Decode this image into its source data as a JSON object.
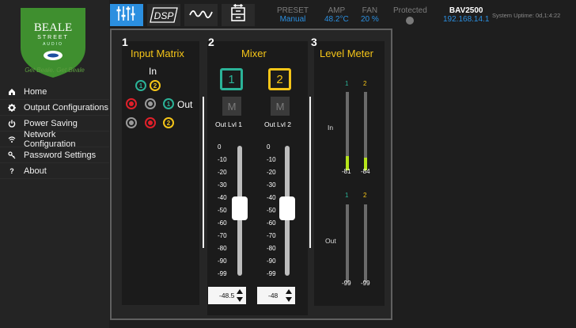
{
  "brand": {
    "name_line1": "BEALE",
    "name_line2": "STREET",
    "name_line3": "AUDIO",
    "tagline": "Get Beale. Get Beale"
  },
  "nav": [
    {
      "label": "Home",
      "icon": "home-icon"
    },
    {
      "label": "Output Configurations",
      "icon": "gear-icon"
    },
    {
      "label": "Power Saving",
      "icon": "power-icon"
    },
    {
      "label": "Network Configuration",
      "icon": "wifi-icon"
    },
    {
      "label": "Password Settings",
      "icon": "key-icon"
    },
    {
      "label": "About",
      "icon": "question-icon"
    }
  ],
  "tabs": [
    {
      "name": "mixer-sliders",
      "label": ""
    },
    {
      "name": "dsp",
      "label": "DSP"
    },
    {
      "name": "eq-curve",
      "label": ""
    },
    {
      "name": "device",
      "label": ""
    }
  ],
  "status": {
    "preset_label": "PRESET",
    "preset_value": "Manual",
    "amp_label": "AMP",
    "amp_value": "48.2°C",
    "fan_label": "FAN",
    "fan_value": "20 %",
    "protected_label": "Protected",
    "model": "BAV2500",
    "ip": "192.168.14.1",
    "uptime": "System Uptime: 0d,1:4:22"
  },
  "input_matrix": {
    "number": "1",
    "title": "Input Matrix",
    "in_label": "In",
    "out_label": "Out",
    "inputs": [
      "1",
      "2"
    ],
    "outputs": [
      "1",
      "2"
    ]
  },
  "mixer": {
    "number": "2",
    "title": "Mixer",
    "mute_label": "M",
    "scale": [
      "0",
      "-10",
      "-20",
      "-30",
      "-40",
      "-50",
      "-60",
      "-70",
      "-80",
      "-90",
      "-99"
    ],
    "channels": [
      {
        "number": "1",
        "out_label": "Out Lvl 1",
        "value": "-48.5"
      },
      {
        "number": "2",
        "out_label": "Out Lvl 2",
        "value": "-48"
      }
    ]
  },
  "level_meter": {
    "number": "3",
    "title": "Level Meter",
    "in_label": "In",
    "out_label": "Out",
    "channels": [
      "1",
      "2"
    ],
    "in_values": [
      "-81",
      "-84"
    ],
    "in_levels": [
      0.18,
      0.16
    ],
    "out_values": [
      "-99",
      "-99"
    ],
    "out_levels": [
      0,
      0
    ]
  },
  "colors": {
    "accent": "#2b8fe0",
    "teal": "#2bb398",
    "yellow": "#f5c518",
    "red": "#e0202a",
    "meter": "#b6e51a"
  }
}
